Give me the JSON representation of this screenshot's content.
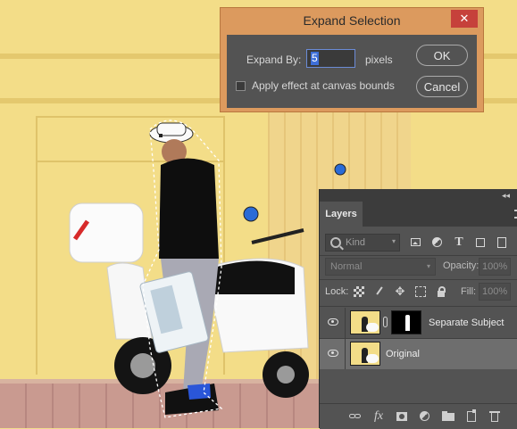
{
  "dialog": {
    "title": "Expand Selection",
    "close_glyph": "✕",
    "expand_by_label": "Expand By:",
    "expand_by_value": "5",
    "units_label": "pixels",
    "canvas_bounds_label": "Apply effect at canvas bounds",
    "canvas_bounds_checked": false,
    "ok_label": "OK",
    "cancel_label": "Cancel"
  },
  "layers_panel": {
    "tab_label": "Layers",
    "collapse_glyph": "◂◂",
    "filter": {
      "kind_label": "Kind",
      "icons": [
        "image-filter-icon",
        "adjustment-filter-icon",
        "type-filter-icon",
        "shape-filter-icon",
        "smart-object-filter-icon"
      ],
      "type_glyph": "T"
    },
    "blend_mode": "Normal",
    "opacity_label": "Opacity:",
    "opacity_value": "100%",
    "lock_label": "Lock:",
    "fill_label": "Fill:",
    "fill_value": "100%",
    "layers": [
      {
        "name": "Separate Subject",
        "visible": true,
        "has_mask": true,
        "selected": false
      },
      {
        "name": "Original",
        "visible": true,
        "has_mask": false,
        "selected": true
      }
    ],
    "bottom_icons": [
      "link-layers-icon",
      "fx-icon",
      "add-mask-icon",
      "adjustment-layer-icon",
      "group-icon",
      "new-layer-icon",
      "delete-layer-icon"
    ],
    "fx_glyph": "fx",
    "move_glyph": "✥"
  },
  "colors": {
    "dialog_accent": "#dc9a5e",
    "close_button": "#c6413b",
    "selection_highlight": "#3e6fd8",
    "panel_bg": "#535353"
  }
}
